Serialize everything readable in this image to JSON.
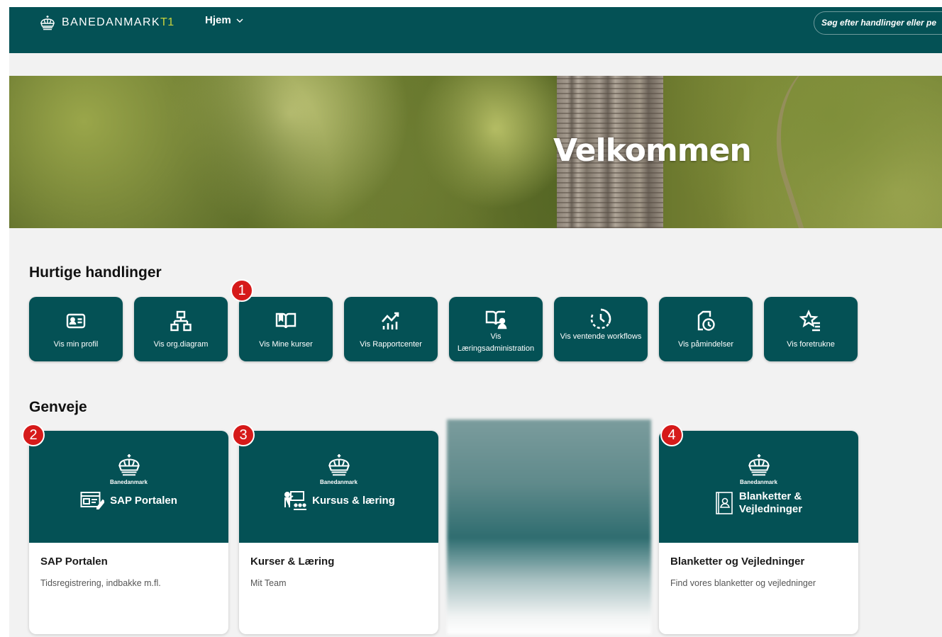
{
  "header": {
    "brand": "BANEDANMARK",
    "brand_suffix": "T1",
    "nav_label": "Hjem",
    "search_placeholder": "Søg efter handlinger eller pe"
  },
  "hero": {
    "title": "Velkommen"
  },
  "quick_actions": {
    "title": "Hurtige handlinger",
    "items": [
      {
        "label": "Vis min profil",
        "icon": "id-card-icon"
      },
      {
        "label": "Vis org.diagram",
        "icon": "org-chart-icon"
      },
      {
        "label": "Vis Mine kurser",
        "icon": "open-book-icon",
        "badge": "1"
      },
      {
        "label": "Vis Rapportcenter",
        "icon": "chart-growth-icon"
      },
      {
        "label": "Vis Læringsadministration",
        "icon": "book-person-icon"
      },
      {
        "label": "Vis ventende workflows",
        "icon": "pending-clock-icon"
      },
      {
        "label": "Vis påmindelser",
        "icon": "reminder-clock-icon"
      },
      {
        "label": "Vis foretrukne",
        "icon": "star-list-icon"
      }
    ]
  },
  "shortcuts": {
    "title": "Genveje",
    "items": [
      {
        "badge": "2",
        "logo_caption": "Banedanmark",
        "brand_label": "SAP Portalen",
        "title": "SAP Portalen",
        "subtitle": "Tidsregistrering, indbakke m.fl."
      },
      {
        "badge": "3",
        "logo_caption": "Banedanmark",
        "brand_label": "Kursus & læring",
        "title": "Kurser & Læring",
        "subtitle": "Mit Team"
      },
      {
        "badge": "4",
        "logo_caption": "Banedanmark",
        "brand_label": "Blanketter & Vejledninger",
        "title": "Blanketter og Vejledninger",
        "subtitle": "Find vores blanketter og vejledninger"
      }
    ]
  },
  "colors": {
    "primary": "#045155",
    "accent": "#c8d23c",
    "badge": "#d61a1a",
    "background": "#f2f2f2"
  }
}
